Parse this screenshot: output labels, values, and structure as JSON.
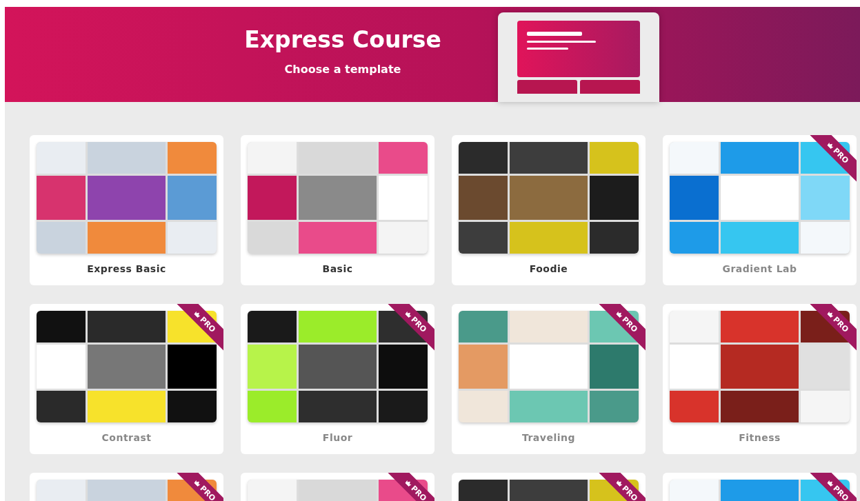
{
  "header": {
    "title": "Express Course",
    "subtitle": "Choose a template"
  },
  "templates": [
    {
      "name": "Express Basic",
      "pro": false
    },
    {
      "name": "Basic",
      "pro": false
    },
    {
      "name": "Foodie",
      "pro": false
    },
    {
      "name": "Gradient Lab",
      "pro": true,
      "badge": "PRO"
    },
    {
      "name": "Contrast",
      "pro": true,
      "badge": "PRO"
    },
    {
      "name": "Fluor",
      "pro": true,
      "badge": "PRO"
    },
    {
      "name": "Traveling",
      "pro": true,
      "badge": "PRO"
    },
    {
      "name": "Fitness",
      "pro": true,
      "badge": "PRO"
    },
    {
      "pro": true,
      "badge": "PRO"
    },
    {
      "pro": true,
      "badge": "PRO"
    },
    {
      "pro": true,
      "badge": "PRO"
    },
    {
      "pro": true,
      "badge": "PRO"
    }
  ]
}
